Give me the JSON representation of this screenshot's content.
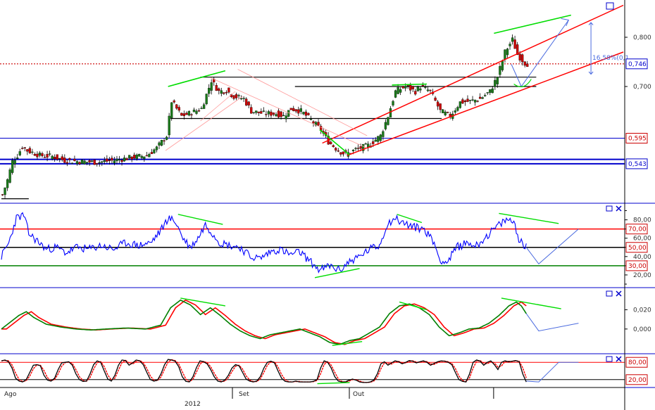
{
  "colors": {
    "background": "#ffffff",
    "panel_border": "#0000cc",
    "candle_up": "#1a7a1a",
    "candle_down": "#cc0000",
    "wick": "#000000",
    "rsi_line": "#0000ff",
    "level_overbought": "#ff0000",
    "level_mid": "#000000",
    "level_oversold": "#008000",
    "macd_line": "#008000",
    "signal_line": "#ff0000",
    "stoch_k": "#000000",
    "stoch_d": "#ff0000",
    "trend_green": "#00dd00",
    "channel_red": "#ff0000",
    "projection": "#4a6adf",
    "current_price": "#cc0000"
  },
  "chart_data": [
    {
      "id": "price",
      "type": "candlestick",
      "y_ticks": [
        "0,800",
        "0,700"
      ],
      "tags": [
        {
          "label": "0,746",
          "value": 0.746,
          "color": "#0000cc"
        },
        {
          "label": "0,595",
          "value": 0.595,
          "color": "#cc0000"
        },
        {
          "label": "0,543",
          "value": 0.543,
          "color": "#0000cc"
        }
      ],
      "annotation": "16,58%(0,1",
      "anchors": [
        [
          0,
          0.48
        ],
        [
          2,
          0.51
        ],
        [
          4,
          0.548
        ],
        [
          6,
          0.56
        ],
        [
          8,
          0.578
        ],
        [
          10,
          0.57
        ],
        [
          15,
          0.56
        ],
        [
          20,
          0.558
        ],
        [
          25,
          0.55
        ],
        [
          30,
          0.548
        ],
        [
          38,
          0.546
        ],
        [
          45,
          0.55
        ],
        [
          52,
          0.556
        ],
        [
          58,
          0.56
        ],
        [
          62,
          0.575
        ],
        [
          66,
          0.6
        ],
        [
          68,
          0.67
        ],
        [
          72,
          0.64
        ],
        [
          75,
          0.645
        ],
        [
          80,
          0.655
        ],
        [
          84,
          0.712
        ],
        [
          87,
          0.69
        ],
        [
          90,
          0.692
        ],
        [
          93,
          0.68
        ],
        [
          97,
          0.675
        ],
        [
          100,
          0.65
        ],
        [
          105,
          0.645
        ],
        [
          110,
          0.645
        ],
        [
          113,
          0.64
        ],
        [
          116,
          0.655
        ],
        [
          120,
          0.65
        ],
        [
          124,
          0.632
        ],
        [
          128,
          0.612
        ],
        [
          131,
          0.588
        ],
        [
          135,
          0.57
        ],
        [
          138,
          0.562
        ],
        [
          142,
          0.572
        ],
        [
          147,
          0.58
        ],
        [
          152,
          0.6
        ],
        [
          155,
          0.64
        ],
        [
          158,
          0.69
        ],
        [
          162,
          0.7
        ],
        [
          166,
          0.69
        ],
        [
          168,
          0.7
        ],
        [
          172,
          0.69
        ],
        [
          176,
          0.65
        ],
        [
          180,
          0.64
        ],
        [
          184,
          0.668
        ],
        [
          188,
          0.67
        ],
        [
          192,
          0.675
        ],
        [
          196,
          0.69
        ],
        [
          199,
          0.72
        ],
        [
          202,
          0.77
        ],
        [
          205,
          0.795
        ],
        [
          207,
          0.765
        ],
        [
          210,
          0.748
        ],
        [
          211,
          0.746
        ]
      ],
      "reference_levels": [
        0.7,
        0.719,
        0.595,
        0.552,
        0.543,
        0.635
      ]
    },
    {
      "id": "rsi",
      "type": "line",
      "y_ticks": [
        "80,00",
        "60,00",
        "40,00",
        "20,00"
      ],
      "tags": [
        {
          "label": "70,00",
          "value": 70,
          "color": "#cc0000"
        },
        {
          "label": "50,00",
          "value": 50,
          "color": "#cc0000"
        },
        {
          "label": "30,00",
          "value": 30,
          "color": "#cc0000"
        }
      ],
      "levels": [
        70,
        50,
        30
      ],
      "anchors": [
        [
          0,
          40
        ],
        [
          3,
          55
        ],
        [
          6,
          82
        ],
        [
          9,
          85
        ],
        [
          11,
          65
        ],
        [
          14,
          58
        ],
        [
          18,
          48
        ],
        [
          22,
          50
        ],
        [
          26,
          44
        ],
        [
          30,
          50
        ],
        [
          35,
          48
        ],
        [
          40,
          52
        ],
        [
          45,
          48
        ],
        [
          50,
          55
        ],
        [
          55,
          52
        ],
        [
          60,
          55
        ],
        [
          64,
          68
        ],
        [
          67,
          82
        ],
        [
          70,
          78
        ],
        [
          73,
          60
        ],
        [
          76,
          50
        ],
        [
          79,
          60
        ],
        [
          82,
          75
        ],
        [
          85,
          65
        ],
        [
          88,
          55
        ],
        [
          92,
          52
        ],
        [
          96,
          50
        ],
        [
          100,
          40
        ],
        [
          104,
          38
        ],
        [
          108,
          45
        ],
        [
          112,
          48
        ],
        [
          116,
          42
        ],
        [
          120,
          45
        ],
        [
          124,
          35
        ],
        [
          128,
          25
        ],
        [
          132,
          30
        ],
        [
          136,
          25
        ],
        [
          140,
          35
        ],
        [
          144,
          40
        ],
        [
          148,
          48
        ],
        [
          152,
          52
        ],
        [
          155,
          75
        ],
        [
          158,
          82
        ],
        [
          162,
          76
        ],
        [
          166,
          72
        ],
        [
          170,
          70
        ],
        [
          174,
          55
        ],
        [
          176,
          38
        ],
        [
          179,
          33
        ],
        [
          183,
          50
        ],
        [
          187,
          55
        ],
        [
          191,
          52
        ],
        [
          195,
          62
        ],
        [
          199,
          72
        ],
        [
          203,
          80
        ],
        [
          206,
          78
        ],
        [
          208,
          60
        ],
        [
          210,
          52
        ],
        [
          211,
          50
        ]
      ],
      "projection": [
        [
          211,
          50
        ],
        [
          216,
          32
        ],
        [
          232,
          70
        ]
      ]
    },
    {
      "id": "macd",
      "type": "line",
      "y_ticks": [
        "0,020",
        "0,000"
      ],
      "series_names": [],
      "anchors": [
        [
          0,
          0.0
        ],
        [
          4,
          0.008
        ],
        [
          7,
          0.014
        ],
        [
          10,
          0.018
        ],
        [
          13,
          0.012
        ],
        [
          18,
          0.005
        ],
        [
          24,
          0.002
        ],
        [
          30,
          0.0
        ],
        [
          36,
          -0.001
        ],
        [
          42,
          0.0
        ],
        [
          50,
          0.001
        ],
        [
          58,
          0.0
        ],
        [
          64,
          0.004
        ],
        [
          68,
          0.022
        ],
        [
          72,
          0.03
        ],
        [
          76,
          0.025
        ],
        [
          80,
          0.015
        ],
        [
          84,
          0.022
        ],
        [
          88,
          0.014
        ],
        [
          92,
          0.005
        ],
        [
          96,
          -0.002
        ],
        [
          100,
          -0.007
        ],
        [
          104,
          -0.01
        ],
        [
          108,
          -0.006
        ],
        [
          112,
          -0.004
        ],
        [
          116,
          -0.002
        ],
        [
          120,
          0.0
        ],
        [
          124,
          -0.004
        ],
        [
          128,
          -0.008
        ],
        [
          132,
          -0.014
        ],
        [
          136,
          -0.016
        ],
        [
          140,
          -0.012
        ],
        [
          144,
          -0.01
        ],
        [
          148,
          -0.004
        ],
        [
          152,
          0.002
        ],
        [
          156,
          0.016
        ],
        [
          160,
          0.024
        ],
        [
          164,
          0.026
        ],
        [
          168,
          0.022
        ],
        [
          172,
          0.015
        ],
        [
          176,
          0.002
        ],
        [
          180,
          -0.007
        ],
        [
          184,
          -0.004
        ],
        [
          188,
          0.0
        ],
        [
          192,
          0.001
        ],
        [
          196,
          0.006
        ],
        [
          200,
          0.014
        ],
        [
          204,
          0.024
        ],
        [
          207,
          0.028
        ],
        [
          209,
          0.024
        ],
        [
          211,
          0.016
        ]
      ],
      "projection": [
        [
          211,
          0.016
        ],
        [
          216,
          -0.002
        ],
        [
          232,
          0.006
        ]
      ]
    },
    {
      "id": "stochastic",
      "type": "line",
      "y_ticks": [],
      "tags": [
        {
          "label": "80,00",
          "value": 80,
          "color": "#cc0000"
        },
        {
          "label": "20,00",
          "value": 20,
          "color": "#cc0000"
        }
      ],
      "levels": [
        80,
        20
      ],
      "pattern": [
        85,
        88,
        82,
        60,
        25,
        15,
        12,
        20,
        45,
        70,
        72,
        68,
        35,
        18,
        15,
        25,
        55,
        78,
        80,
        82,
        70,
        40,
        20,
        14,
        15,
        40,
        72,
        85,
        80,
        50,
        22,
        15,
        35,
        70,
        88,
        86,
        70,
        78,
        88,
        85,
        72,
        45,
        20,
        15,
        18,
        40,
        72,
        90,
        88,
        84,
        65,
        30,
        14,
        12,
        30,
        62,
        85,
        82,
        75,
        55,
        30,
        15,
        12,
        18,
        35,
        60,
        72,
        68,
        45,
        22,
        15,
        12,
        15,
        30,
        60,
        80,
        84,
        78,
        50,
        25,
        14,
        12,
        12,
        15,
        12,
        12,
        12,
        12,
        14,
        20,
        60,
        85,
        80,
        60,
        30,
        15,
        12,
        12,
        18,
        22,
        18,
        12,
        10,
        10,
        12,
        18,
        40,
        75,
        82,
        70,
        78,
        85,
        82,
        75,
        80,
        86,
        84,
        78,
        82,
        85,
        80,
        70,
        76,
        82,
        85,
        84,
        80,
        72,
        45,
        20,
        14,
        12,
        40,
        80,
        88,
        84,
        70,
        80,
        85,
        72,
        55,
        80,
        85,
        82,
        84,
        86,
        82,
        40,
        12
      ],
      "projection": [
        [
          211,
          15
        ],
        [
          216,
          12
        ],
        [
          224,
          80
        ],
        [
          232,
          80
        ]
      ]
    }
  ],
  "x_axis": {
    "months": [
      {
        "label": "Ago",
        "bar": 0
      },
      {
        "label": "Set",
        "bar": 94
      },
      {
        "label": "Out",
        "bar": 141
      }
    ],
    "year": "2012"
  },
  "window_buttons": {
    "maximize": "maximize-icon",
    "close": "close-icon"
  }
}
